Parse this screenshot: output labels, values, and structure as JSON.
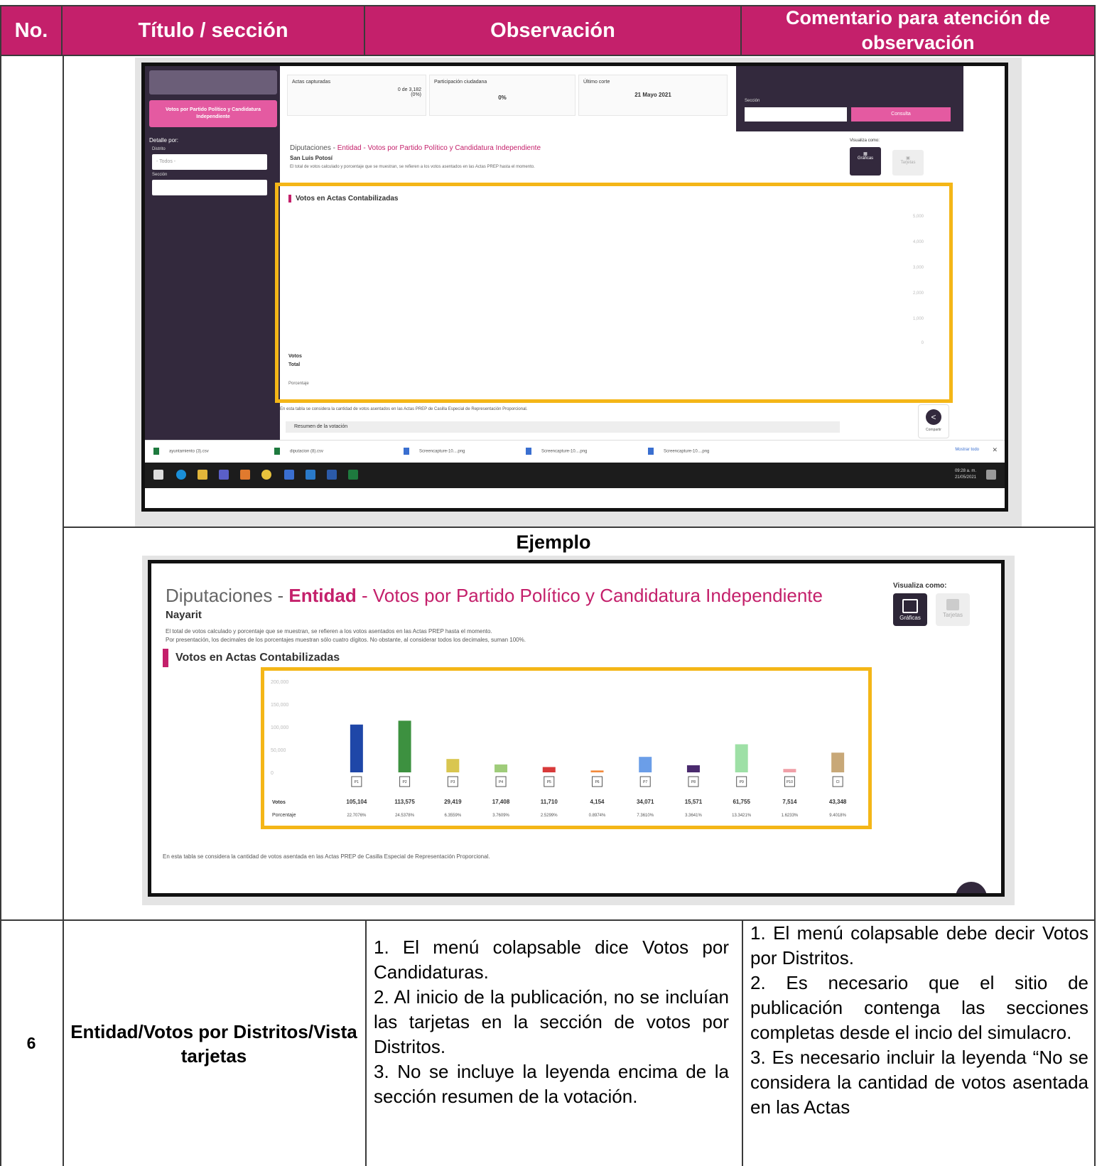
{
  "header": {
    "no": "No.",
    "titulo": "Título / sección",
    "observacion": "Observación",
    "comentario": "Comentario para atención de observación"
  },
  "screenshot1": {
    "sidebar": {
      "selected_button": "Votos por Partido Político y Candidatura Independiente",
      "detalle_label": "Detalle por:",
      "distrito_label": "Distrito",
      "distrito_value": "- Todos -",
      "seccion_label": "Sección"
    },
    "stats": {
      "actas_label": "Actas capturadas",
      "actas_value": "0 de 3,182",
      "actas_pct": "(0%)",
      "participacion_label": "Participación ciudadana",
      "participacion_value": "0%",
      "corte_label": "Último corte",
      "corte_value": "21 Mayo 2021"
    },
    "consulta": {
      "seccion_label": "Sección",
      "button": "Consulta"
    },
    "title_prefix": "Diputaciones - ",
    "title_entidad": "Entidad",
    "title_rest": " - Votos por Partido Político y Candidatura Independiente",
    "state": "San Luis Potosí",
    "note": "El total de votos calculado y porcentaje que se muestran, se refieren a los votos asentados en las Actas PREP hasta el momento.",
    "visualiza": "Visualiza como:",
    "graficas": "Gráficas",
    "tarjetas": "Tarjetas",
    "votos_title": "Votos en Actas Contabilizadas",
    "votos_label": "Votos",
    "total_label": "Total",
    "porcentaje_label": "Porcentaje",
    "yticks": [
      "5,000",
      "4,000",
      "3,000",
      "2,000",
      "1,000",
      "0"
    ],
    "footnote": "En esta tabla se considera la cantidad de votos asentados en las Actas PREP de Casilla Especial de Representación Proporcional.",
    "resumen": "Resumen de la votación",
    "compartir": "Compartir",
    "downloads": [
      "ayuntamiento (3).csv",
      "diputacion (8).csv",
      "Screencapture-10....png",
      "Screencapture-10....png",
      "Screencapture-10....png"
    ],
    "mostrar_todo": "Mostrar todo",
    "clock_time": "09:28 a. m.",
    "clock_date": "21/05/2021"
  },
  "ejemplo_label": "Ejemplo",
  "screenshot2": {
    "title_prefix": "Diputaciones - ",
    "title_entidad": "Entidad",
    "title_rest": " - Votos por Partido Político y Candidatura Independiente",
    "state": "Nayarit",
    "note1": "El total de votos calculado y porcentaje que se muestran, se refieren a los votos asentados en las Actas PREP hasta el momento.",
    "note2": "Por presentación, los decimales de los porcentajes muestran sólo cuatro dígitos. No obstante, al considerar todos los decimales, suman 100%.",
    "visualiza": "Visualiza como:",
    "graficas": "Gráficas",
    "tarjetas": "Tarjetas",
    "votos_title": "Votos en Actas Contabilizadas",
    "votos_row_label": "Votos",
    "porcentaje_row_label": "Porcentaje",
    "footnote": "En esta tabla se considera la cantidad de votos asentada en las Actas PREP de Casilla Especial de Representación Proporcional."
  },
  "chart_data": {
    "type": "bar",
    "ylim": [
      0,
      200000
    ],
    "yticks": [
      "200,000",
      "150,000",
      "100,000",
      "50,000",
      "0"
    ],
    "categories": [
      "P1",
      "P2",
      "P3",
      "P4",
      "P5",
      "P6",
      "P7",
      "P8",
      "P9",
      "P10",
      "CI"
    ],
    "values": [
      105104,
      113575,
      29419,
      17408,
      11710,
      4154,
      34071,
      15571,
      61755,
      7514,
      43348
    ],
    "value_labels": [
      "105,104",
      "113,575",
      "29,419",
      "17,408",
      "11,710",
      "4,154",
      "34,071",
      "15,571",
      "61,755",
      "7,514",
      "43,348"
    ],
    "percent_labels": [
      "22.7076%",
      "24.5378%",
      "6.3559%",
      "3.7609%",
      "2.5299%",
      "0.8974%",
      "7.3610%",
      "3.3641%",
      "13.3421%",
      "1.6233%",
      "9.4018%"
    ],
    "colors": [
      "#1f47a8",
      "#3d9140",
      "#d9c650",
      "#9fcc7a",
      "#d83a3a",
      "#f28a3c",
      "#6b9ee8",
      "#4a2a6e",
      "#9ee0a6",
      "#f0a0a8",
      "#c8a878"
    ]
  },
  "row6": {
    "no": "6",
    "titulo": "Entidad/Votos por Distritos/Vista tarjetas",
    "observaciones": [
      "1. El menú colapsable dice Votos por Candidaturas.",
      "2. Al inicio de la publicación, no se incluían las tarjetas en la sección de votos por Distritos.",
      "3. No se incluye la leyenda encima de la sección resumen de la votación."
    ],
    "comentarios": [
      "1. El menú colapsable debe decir Votos por Distritos.",
      "2. Es necesario que el sitio de publicación contenga las secciones completas desde el incio del simulacro.",
      "3. Es necesario incluir la leyenda “No se considera la cantidad de votos asentada en las Actas"
    ]
  }
}
